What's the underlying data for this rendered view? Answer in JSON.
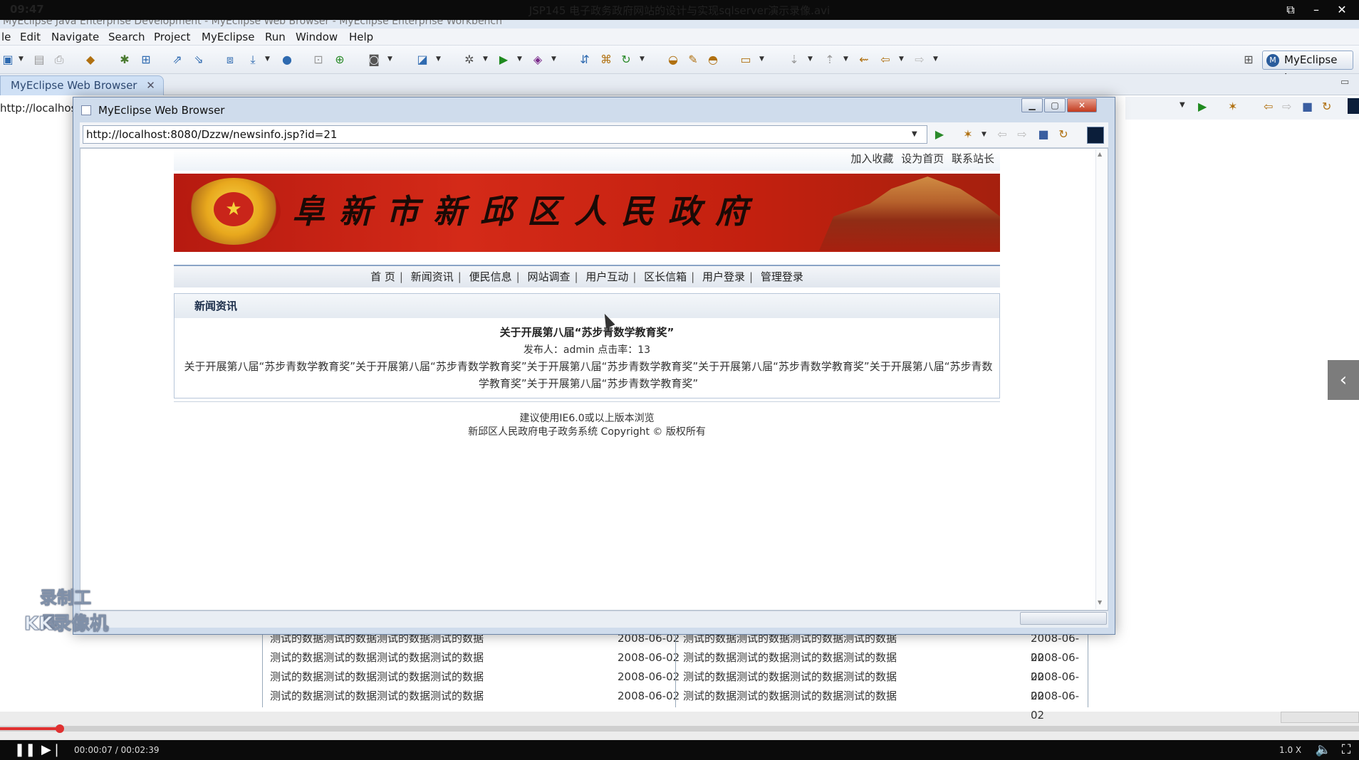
{
  "video": {
    "clock": "09:47",
    "title": "JSP145 电子政务政府网站的设计与实现sqlserver演示录像.avi",
    "position": "00:00:07 / 00:02:39",
    "speed": "1.0 X",
    "progress_fraction": 0.044
  },
  "eclipse": {
    "title_partial": "MyEclipse Java Enterprise Development - MyEclipse Web Browser - MyEclipse Enterprise Workbench",
    "menu": [
      "le",
      "Edit",
      "Navigate",
      "Search",
      "Project",
      "MyEclipse",
      "Run",
      "Window",
      "Help"
    ],
    "perspective_label": "MyEclipse J...",
    "editor_tab": "MyEclipse Web Browser",
    "bg_address": "http://localhos"
  },
  "window": {
    "title": "MyEclipse Web Browser",
    "url": "http://localhost:8080/Dzzw/newsinfo.jsp?id=21"
  },
  "page": {
    "top_links": [
      "加入收藏",
      "设为首页",
      "联系站长"
    ],
    "banner_text": "阜新市新邱区人民政府",
    "nav": [
      "首 页",
      "新闻资讯",
      "便民信息",
      "网站调查",
      "用户互动",
      "区长信箱",
      "用户登录",
      "管理登录"
    ],
    "panel_title": "新闻资讯",
    "news_title": "关于开展第八届“苏步青数学教育奖”",
    "news_meta": "发布人：admin 点击率：13",
    "news_body": "关于开展第八届“苏步青数学教育奖”关于开展第八届“苏步青数学教育奖”关于开展第八届“苏步青数学教育奖”关于开展第八届“苏步青数学教育奖”关于开展第八届“苏步青数学教育奖”关于开展第八届“苏步青数学教育奖”",
    "footer_line1": "建议使用IE6.0或以上版本浏览",
    "footer_line2": "新邱区人民政府电子政务系统 Copyright © 版权所有"
  },
  "bg_table": {
    "rows": [
      {
        "left_text": "测试的数据测试的数据测试的数据测试的数据",
        "left_date": "2008-06-02",
        "right_text": "测试的数据测试的数据测试的数据测试的数据",
        "right_date": "2008-06-02"
      },
      {
        "left_text": "测试的数据测试的数据测试的数据测试的数据",
        "left_date": "2008-06-02",
        "right_text": "测试的数据测试的数据测试的数据测试的数据",
        "right_date": "2008-06-02"
      },
      {
        "left_text": "测试的数据测试的数据测试的数据测试的数据",
        "left_date": "2008-06-02",
        "right_text": "测试的数据测试的数据测试的数据测试的数据",
        "right_date": "2008-06-02"
      },
      {
        "left_text": "测试的数据测试的数据测试的数据测试的数据",
        "left_date": "2008-06-02",
        "right_text": "测试的数据测试的数据测试的数据测试的数据",
        "right_date": "2008-06-02"
      }
    ]
  },
  "watermark": {
    "line1": "录制工具",
    "line2": "KK录像机"
  },
  "colors": {
    "banner_red": "#c3200f",
    "nav_border": "#8aa4c6",
    "progress": "#e03030"
  }
}
